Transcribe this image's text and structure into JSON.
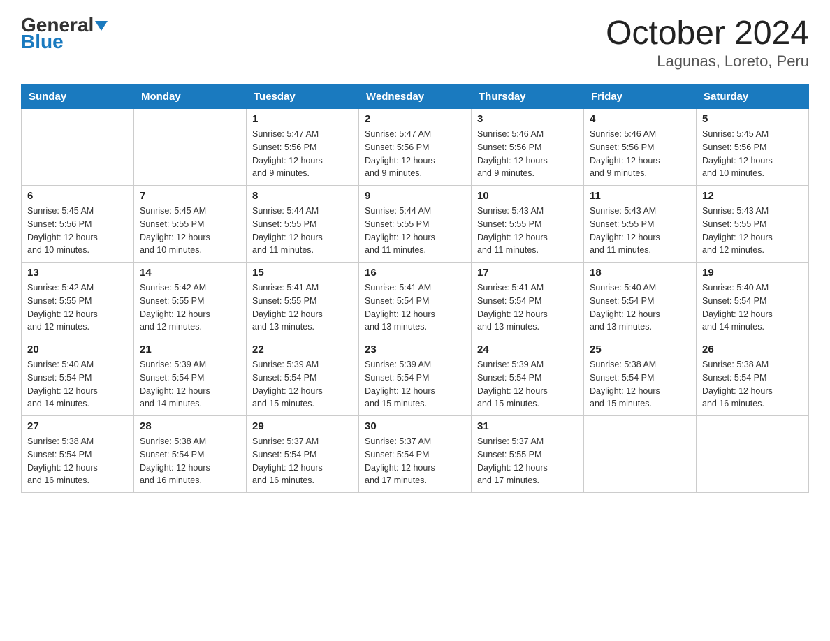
{
  "logo": {
    "general": "General",
    "blue": "Blue"
  },
  "title": "October 2024",
  "subtitle": "Lagunas, Loreto, Peru",
  "headers": [
    "Sunday",
    "Monday",
    "Tuesday",
    "Wednesday",
    "Thursday",
    "Friday",
    "Saturday"
  ],
  "weeks": [
    [
      {
        "day": "",
        "info": ""
      },
      {
        "day": "",
        "info": ""
      },
      {
        "day": "1",
        "info": "Sunrise: 5:47 AM\nSunset: 5:56 PM\nDaylight: 12 hours\nand 9 minutes."
      },
      {
        "day": "2",
        "info": "Sunrise: 5:47 AM\nSunset: 5:56 PM\nDaylight: 12 hours\nand 9 minutes."
      },
      {
        "day": "3",
        "info": "Sunrise: 5:46 AM\nSunset: 5:56 PM\nDaylight: 12 hours\nand 9 minutes."
      },
      {
        "day": "4",
        "info": "Sunrise: 5:46 AM\nSunset: 5:56 PM\nDaylight: 12 hours\nand 9 minutes."
      },
      {
        "day": "5",
        "info": "Sunrise: 5:45 AM\nSunset: 5:56 PM\nDaylight: 12 hours\nand 10 minutes."
      }
    ],
    [
      {
        "day": "6",
        "info": "Sunrise: 5:45 AM\nSunset: 5:56 PM\nDaylight: 12 hours\nand 10 minutes."
      },
      {
        "day": "7",
        "info": "Sunrise: 5:45 AM\nSunset: 5:55 PM\nDaylight: 12 hours\nand 10 minutes."
      },
      {
        "day": "8",
        "info": "Sunrise: 5:44 AM\nSunset: 5:55 PM\nDaylight: 12 hours\nand 11 minutes."
      },
      {
        "day": "9",
        "info": "Sunrise: 5:44 AM\nSunset: 5:55 PM\nDaylight: 12 hours\nand 11 minutes."
      },
      {
        "day": "10",
        "info": "Sunrise: 5:43 AM\nSunset: 5:55 PM\nDaylight: 12 hours\nand 11 minutes."
      },
      {
        "day": "11",
        "info": "Sunrise: 5:43 AM\nSunset: 5:55 PM\nDaylight: 12 hours\nand 11 minutes."
      },
      {
        "day": "12",
        "info": "Sunrise: 5:43 AM\nSunset: 5:55 PM\nDaylight: 12 hours\nand 12 minutes."
      }
    ],
    [
      {
        "day": "13",
        "info": "Sunrise: 5:42 AM\nSunset: 5:55 PM\nDaylight: 12 hours\nand 12 minutes."
      },
      {
        "day": "14",
        "info": "Sunrise: 5:42 AM\nSunset: 5:55 PM\nDaylight: 12 hours\nand 12 minutes."
      },
      {
        "day": "15",
        "info": "Sunrise: 5:41 AM\nSunset: 5:55 PM\nDaylight: 12 hours\nand 13 minutes."
      },
      {
        "day": "16",
        "info": "Sunrise: 5:41 AM\nSunset: 5:54 PM\nDaylight: 12 hours\nand 13 minutes."
      },
      {
        "day": "17",
        "info": "Sunrise: 5:41 AM\nSunset: 5:54 PM\nDaylight: 12 hours\nand 13 minutes."
      },
      {
        "day": "18",
        "info": "Sunrise: 5:40 AM\nSunset: 5:54 PM\nDaylight: 12 hours\nand 13 minutes."
      },
      {
        "day": "19",
        "info": "Sunrise: 5:40 AM\nSunset: 5:54 PM\nDaylight: 12 hours\nand 14 minutes."
      }
    ],
    [
      {
        "day": "20",
        "info": "Sunrise: 5:40 AM\nSunset: 5:54 PM\nDaylight: 12 hours\nand 14 minutes."
      },
      {
        "day": "21",
        "info": "Sunrise: 5:39 AM\nSunset: 5:54 PM\nDaylight: 12 hours\nand 14 minutes."
      },
      {
        "day": "22",
        "info": "Sunrise: 5:39 AM\nSunset: 5:54 PM\nDaylight: 12 hours\nand 15 minutes."
      },
      {
        "day": "23",
        "info": "Sunrise: 5:39 AM\nSunset: 5:54 PM\nDaylight: 12 hours\nand 15 minutes."
      },
      {
        "day": "24",
        "info": "Sunrise: 5:39 AM\nSunset: 5:54 PM\nDaylight: 12 hours\nand 15 minutes."
      },
      {
        "day": "25",
        "info": "Sunrise: 5:38 AM\nSunset: 5:54 PM\nDaylight: 12 hours\nand 15 minutes."
      },
      {
        "day": "26",
        "info": "Sunrise: 5:38 AM\nSunset: 5:54 PM\nDaylight: 12 hours\nand 16 minutes."
      }
    ],
    [
      {
        "day": "27",
        "info": "Sunrise: 5:38 AM\nSunset: 5:54 PM\nDaylight: 12 hours\nand 16 minutes."
      },
      {
        "day": "28",
        "info": "Sunrise: 5:38 AM\nSunset: 5:54 PM\nDaylight: 12 hours\nand 16 minutes."
      },
      {
        "day": "29",
        "info": "Sunrise: 5:37 AM\nSunset: 5:54 PM\nDaylight: 12 hours\nand 16 minutes."
      },
      {
        "day": "30",
        "info": "Sunrise: 5:37 AM\nSunset: 5:54 PM\nDaylight: 12 hours\nand 17 minutes."
      },
      {
        "day": "31",
        "info": "Sunrise: 5:37 AM\nSunset: 5:55 PM\nDaylight: 12 hours\nand 17 minutes."
      },
      {
        "day": "",
        "info": ""
      },
      {
        "day": "",
        "info": ""
      }
    ]
  ]
}
